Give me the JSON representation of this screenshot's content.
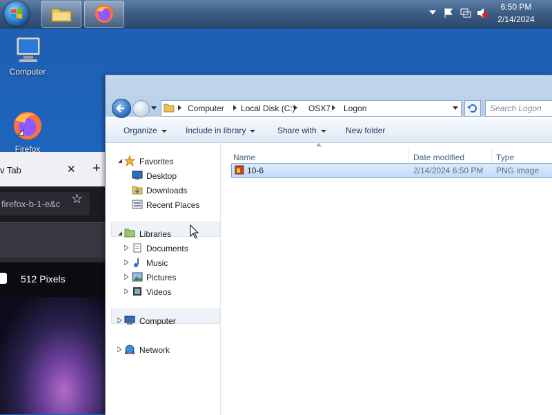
{
  "taskbar": {
    "clock_time": "6:50 PM",
    "clock_date": "2/14/2024"
  },
  "desktop": {
    "icons": [
      {
        "label": "Computer",
        "icon": "computer-icon"
      },
      {
        "label": "Firefox",
        "icon": "firefox-icon"
      }
    ]
  },
  "firefox": {
    "tab_label": "v Tab",
    "url_text": "firefox-b-1-e&c",
    "page_title": "512 Pixels"
  },
  "explorer": {
    "breadcrumb": [
      "Computer",
      "Local Disk (C:)",
      "OSX7",
      "Logon"
    ],
    "search_placeholder": "Search Logon",
    "toolbar": {
      "organize": "Organize",
      "include": "Include in library",
      "share": "Share with",
      "new_folder": "New folder"
    },
    "nav": {
      "favorites": "Favorites",
      "desktop": "Desktop",
      "downloads": "Downloads",
      "recent": "Recent Places",
      "libraries": "Libraries",
      "documents": "Documents",
      "music": "Music",
      "pictures": "Pictures",
      "videos": "Videos",
      "computer": "Computer",
      "network": "Network"
    },
    "columns": {
      "name": "Name",
      "date": "Date modified",
      "type": "Type"
    },
    "files": [
      {
        "name": "10-6",
        "date": "2/14/2024 6:50 PM",
        "type": "PNG image"
      }
    ]
  },
  "colors": {
    "desktop_blue": "#1d66c2",
    "selection_blue": "#c1dbfc",
    "explorer_frame": "#c3d8ee"
  }
}
